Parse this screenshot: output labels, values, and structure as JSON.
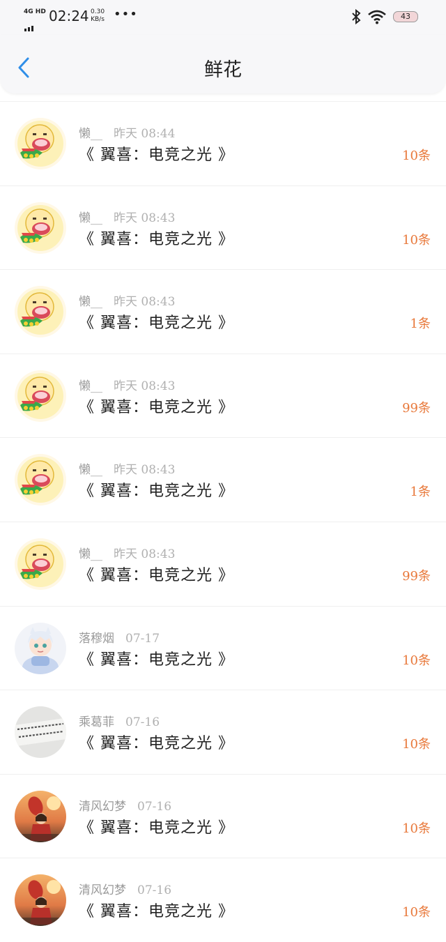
{
  "status_bar": {
    "network": "4G HD",
    "time": "02:24",
    "speed_value": "0.30",
    "speed_unit": "KB/s",
    "more": "•••",
    "battery": "43"
  },
  "header": {
    "title": "鲜花",
    "back_icon": "chevron-left-icon"
  },
  "colors": {
    "accent_blue": "#2f8ee8",
    "count_orange": "#e8783a"
  },
  "items": [
    {
      "user": "懒__",
      "time": "昨天 08:44",
      "book": "《 翼喜：电竞之光 》",
      "count": "10条",
      "avatar": "cartoon"
    },
    {
      "user": "懒__",
      "time": "昨天 08:43",
      "book": "《 翼喜：电竞之光 》",
      "count": "10条",
      "avatar": "cartoon"
    },
    {
      "user": "懒__",
      "time": "昨天 08:43",
      "book": "《 翼喜：电竞之光 》",
      "count": "1条",
      "avatar": "cartoon"
    },
    {
      "user": "懒__",
      "time": "昨天 08:43",
      "book": "《 翼喜：电竞之光 》",
      "count": "99条",
      "avatar": "cartoon"
    },
    {
      "user": "懒__",
      "time": "昨天 08:43",
      "book": "《 翼喜：电竞之光 》",
      "count": "1条",
      "avatar": "cartoon"
    },
    {
      "user": "懒__",
      "time": "昨天 08:43",
      "book": "《 翼喜：电竞之光 》",
      "count": "99条",
      "avatar": "cartoon"
    },
    {
      "user": "落穆烟",
      "time": "07-17",
      "book": "《 翼喜：电竞之光 》",
      "count": "10条",
      "avatar": "anime"
    },
    {
      "user": "乘葛菲",
      "time": "07-16",
      "book": "《 翼喜：电竞之光 》",
      "count": "10条",
      "avatar": "note"
    },
    {
      "user": "清风幻梦",
      "time": "07-16",
      "book": "《 翼喜：电竞之光 》",
      "count": "10条",
      "avatar": "sunset"
    },
    {
      "user": "清风幻梦",
      "time": "07-16",
      "book": "《 翼喜：电竞之光 》",
      "count": "10条",
      "avatar": "sunset"
    }
  ]
}
